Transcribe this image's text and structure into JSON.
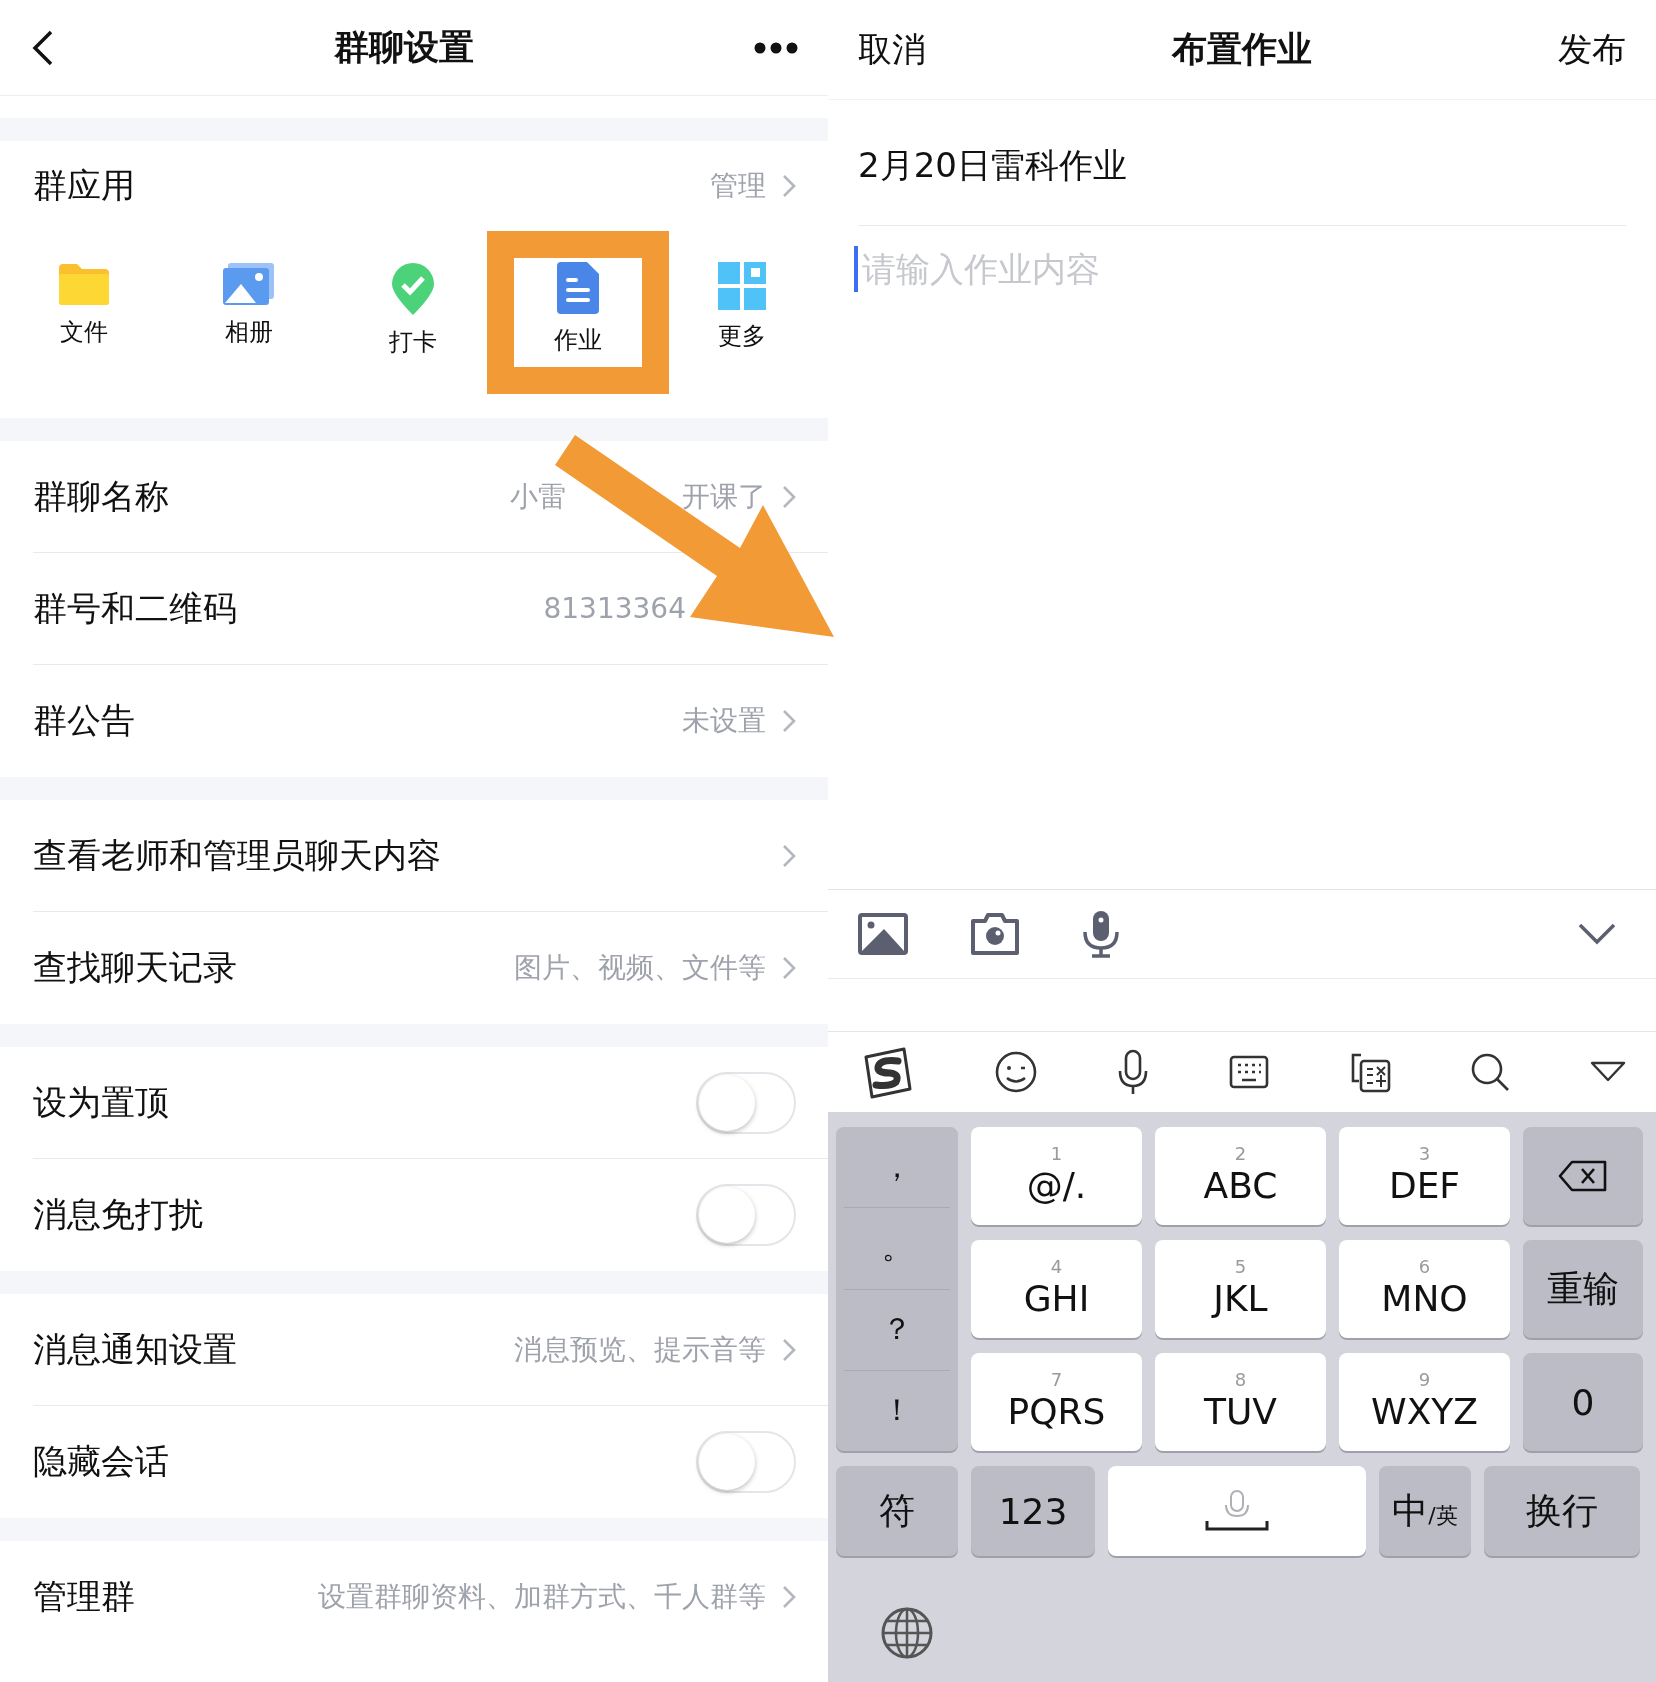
{
  "settings": {
    "title": "群聊设置",
    "apps_section": {
      "label": "群应用",
      "action": "管理",
      "apps": [
        {
          "kind": "folder",
          "label": "文件",
          "highlighted": false
        },
        {
          "kind": "album",
          "label": "相册",
          "highlighted": false
        },
        {
          "kind": "checkin",
          "label": "打卡",
          "highlighted": false
        },
        {
          "kind": "homework",
          "label": "作业",
          "highlighted": true
        },
        {
          "kind": "more",
          "label": "更多",
          "highlighted": false
        }
      ]
    },
    "sections": [
      [
        {
          "kind": "link",
          "label": "群聊名称",
          "value_parts": [
            "小雷",
            "开课了"
          ],
          "chevron": true
        },
        {
          "kind": "link",
          "label": "群号和二维码",
          "value_parts": [
            "81313364"
          ],
          "chevron": false
        },
        {
          "kind": "link",
          "label": "群公告",
          "value_parts": [
            "未设置"
          ],
          "chevron": true
        }
      ],
      [
        {
          "kind": "link",
          "label": "查看老师和管理员聊天内容",
          "chevron": true
        },
        {
          "kind": "link",
          "label": "查找聊天记录",
          "value_parts": [
            "图片、视频、文件等"
          ],
          "chevron": true
        }
      ],
      [
        {
          "kind": "toggle",
          "label": "设为置顶",
          "on": false
        },
        {
          "kind": "toggle",
          "label": "消息免打扰",
          "on": false
        }
      ],
      [
        {
          "kind": "link",
          "label": "消息通知设置",
          "value_parts": [
            "消息预览、提示音等"
          ],
          "chevron": true
        },
        {
          "kind": "toggle",
          "label": "隐藏会话",
          "on": false
        }
      ],
      [
        {
          "kind": "link",
          "label": "管理群",
          "value_parts": [
            "设置群聊资料、加群方式、千人群等"
          ],
          "chevron": true
        }
      ]
    ]
  },
  "compose": {
    "cancel": "取消",
    "title": "布置作业",
    "publish": "发布",
    "subject": "2月20日雷科作业",
    "placeholder": "请输入作业内容"
  },
  "keyboard": {
    "punctuation": [
      "，",
      "。",
      "？",
      "！"
    ],
    "keys": [
      {
        "digit": "1",
        "letters": "@/."
      },
      {
        "digit": "2",
        "letters": "ABC"
      },
      {
        "digit": "3",
        "letters": "DEF"
      },
      {
        "digit": "4",
        "letters": "GHI"
      },
      {
        "digit": "5",
        "letters": "JKL"
      },
      {
        "digit": "6",
        "letters": "MNO"
      },
      {
        "digit": "7",
        "letters": "PQRS"
      },
      {
        "digit": "8",
        "letters": "TUV"
      },
      {
        "digit": "9",
        "letters": "WXYZ"
      }
    ],
    "side_keys": [
      {
        "kind": "backspace"
      },
      {
        "kind": "text",
        "label": "重输"
      },
      {
        "kind": "text",
        "label": "0"
      }
    ],
    "bottom_keys": [
      {
        "kind": "text",
        "label": "符"
      },
      {
        "kind": "text",
        "label": "123"
      },
      {
        "kind": "space"
      },
      {
        "kind": "text",
        "label": "中$_{/英}$"
      },
      {
        "kind": "text",
        "label": "换行"
      }
    ]
  }
}
